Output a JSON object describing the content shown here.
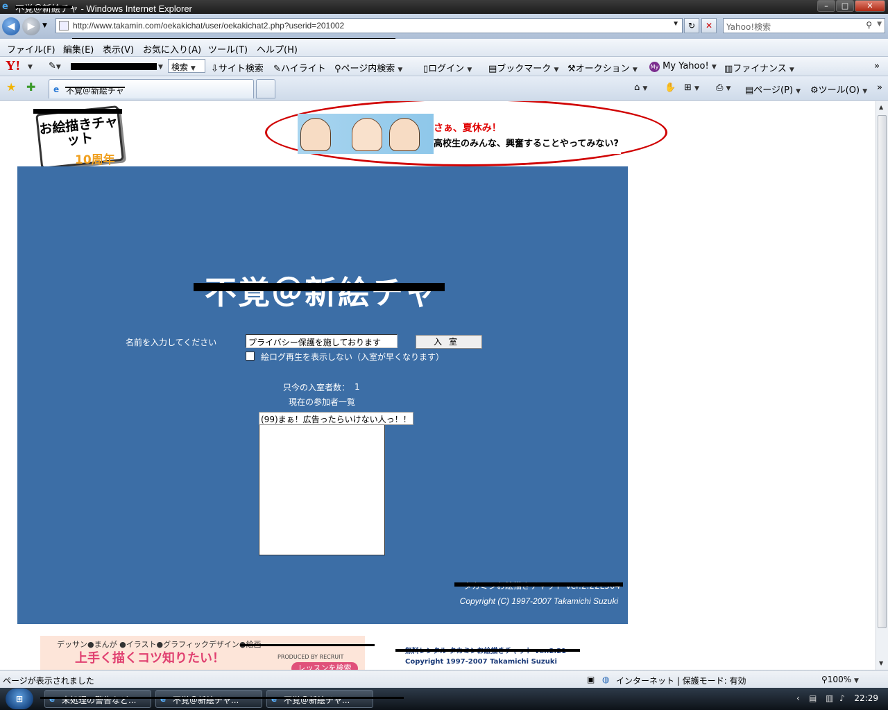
{
  "window": {
    "title": "不覚＠新絵チャ - Windows Internet Explorer",
    "controls": [
      "minimize",
      "maximize",
      "close"
    ]
  },
  "addressbar": {
    "url": "http://www.takamin.com/oekakichat/user/oekakichat2.php?userid=201002",
    "search_placeholder": "Yahoo!検索"
  },
  "menu": {
    "items": [
      "ファイル(F)",
      "編集(E)",
      "表示(V)",
      "お気に入り(A)",
      "ツール(T)",
      "ヘルプ(H)"
    ]
  },
  "yahoo_toolbar": {
    "search_label": "検索",
    "site_search": "サイト検索",
    "highlight": "ハイライト",
    "page_search": "ページ内検索",
    "login": "ログイン",
    "bookmark": "ブックマーク",
    "auction": "オークション",
    "my_yahoo": "My Yahoo!",
    "finance": "ファイナンス"
  },
  "tabs": {
    "active_tab": "不覚＠新絵チャ",
    "page_menu": "ページ(P)",
    "tools_menu": "ツール(O)"
  },
  "page": {
    "logo_text": "お絵描きチャット",
    "logo_anniversary": "10周年",
    "banner_line1": "さぁ、夏休み！",
    "banner_line2": "高校生のみんな、興奮することやってみない?",
    "room_title": "不覚＠新絵チャ",
    "name_label": "名前を入力してください",
    "name_value": "プライバシー保護を施しております",
    "enter_button": "入室",
    "no_log_label": "絵ログ再生を表示しない（入室が早くなります）",
    "count_label": "只今の入室者数：",
    "count_value": "1",
    "participants_label": "現在の参加者一覧",
    "participants": [
      "(99)まぁ！広告ったらいけない人っ！！"
    ],
    "version": "タカミンお絵描きチャット ver.2.22L504",
    "copyright": "Copyright (C) 1997-2007 Takamichi Suzuki",
    "ad_bottom_line1": "デッサン●まんが ●イラスト●グラフィックデザイン●絵画",
    "ad_bottom_line2": "上手く描くコツ知りたい！",
    "ad_bottom_recruit": "PRODUCED BY RECRUIT",
    "ad_bottom_button": "レッスンを検索",
    "footer_line1": "無料レンタル タカミンお絵描きチャット ver.2.21",
    "footer_line2": "Copyright 1997-2007 Takamichi Suzuki"
  },
  "statusbar": {
    "status": "ページが表示されました",
    "zone": "インターネット | 保護モード: 有効",
    "zoom": "100%"
  },
  "taskbar": {
    "tasks": [
      "未処理の警告など...",
      "不覚＠新絵チャ...",
      "不覚＠新絵チャ..."
    ],
    "clock": "22:29"
  }
}
